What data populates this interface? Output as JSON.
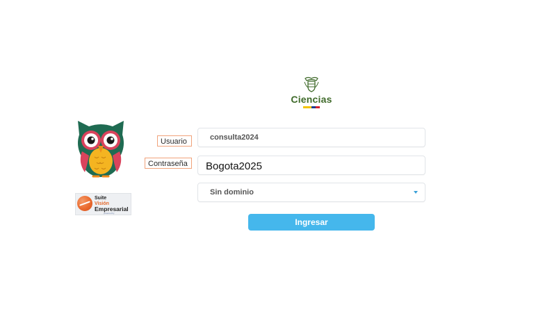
{
  "header": {
    "logo_text": "Ciencias",
    "logo_icon": "colombian-coat-of-arms-icon",
    "flag_colors": [
      "#f3c300",
      "#1b3d8f",
      "#d1202f"
    ]
  },
  "branding": {
    "mascot_icon": "owl-mascot-icon",
    "suite_logo": {
      "line1": "Suite",
      "line2": "Visión",
      "line3": "Empresarial",
      "tagline": "powered by"
    }
  },
  "form": {
    "user_label": "Usuario",
    "user_value": "consulta2024",
    "password_label": "Contraseña",
    "password_value": "Bogota2025",
    "domain_value": "Sin dominio",
    "submit_label": "Ingresar"
  },
  "colors": {
    "accent": "#45b7ec",
    "label_border": "#f0a27a",
    "brand_green": "#3f6a2a"
  }
}
